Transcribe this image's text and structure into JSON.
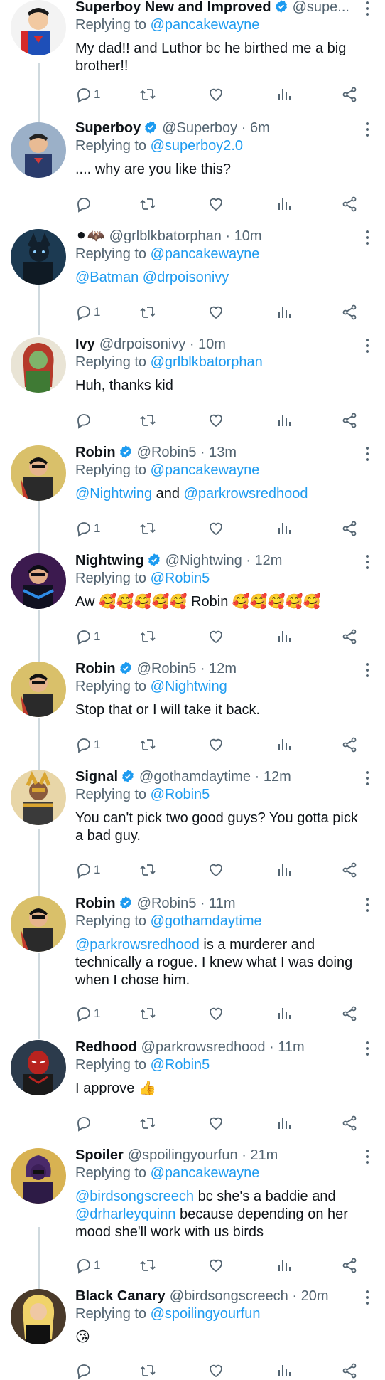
{
  "colors": {
    "link": "#1d9bf0",
    "muted": "#536471",
    "text": "#0f1419",
    "verified": "#1d9bf0"
  },
  "icons": [
    "reply-icon",
    "retweet-icon",
    "like-icon",
    "views-icon",
    "share-icon",
    "more-icon",
    "verified-badge-icon"
  ],
  "tweets": [
    {
      "name": "Superboy New and Improved",
      "verified": true,
      "handle": "@supe...",
      "time": "",
      "replying_label": "Replying to",
      "replying_to": "@pancakewayne",
      "body": "My dad!!  and Luthor bc he birthed me a big brother!!",
      "reply_count": "1"
    },
    {
      "name": "Superboy",
      "verified": true,
      "handle": "@Superboy · 6m",
      "time": "",
      "replying_label": "Replying to",
      "replying_to": "@superboy2.0",
      "body": ".... why are you like this?",
      "reply_count": ""
    },
    {
      "name": "⚫🦇",
      "verified": false,
      "handle": "@grlblkbatorphan · 10m",
      "replying_label": "Replying to",
      "replying_to": "@pancakewayne",
      "body_mention_1": "@Batman",
      "body_mention_2": "@drpoisonivy",
      "reply_count": "1"
    },
    {
      "name": "Ivy",
      "verified": false,
      "handle": "@drpoisonivy · 10m",
      "replying_label": "Replying to",
      "replying_to": "@grlblkbatorphan",
      "body": "Huh, thanks kid",
      "reply_count": ""
    },
    {
      "name": "Robin",
      "verified": true,
      "handle": "@Robin5 · 13m",
      "replying_label": "Replying to",
      "replying_to": "@pancakewayne",
      "body_mention_1": "@Nightwing",
      "body_mid": " and ",
      "body_mention_2": "@parkrowsredhood",
      "reply_count": "1"
    },
    {
      "name": "Nightwing",
      "verified": true,
      "handle": "@Nightwing · 12m",
      "replying_label": "Replying to",
      "replying_to": "@Robin5",
      "body_pre": "Aw ",
      "body_emoji_1": "🥰🥰🥰🥰🥰",
      "body_mid": " Robin ",
      "body_emoji_2": "🥰🥰🥰🥰🥰",
      "reply_count": "1"
    },
    {
      "name": "Robin",
      "verified": true,
      "handle": "@Robin5 · 12m",
      "replying_label": "Replying to",
      "replying_to": "@Nightwing",
      "body": "Stop that or I will take it back.",
      "reply_count": "1"
    },
    {
      "name": "Signal",
      "verified": true,
      "handle": "@gothamdaytime · 12m",
      "replying_label": "Replying to",
      "replying_to": "@Robin5",
      "body": "You can't pick two good guys? You gotta pick a bad guy.",
      "reply_count": "1"
    },
    {
      "name": "Robin",
      "verified": true,
      "handle": "@Robin5 · 11m",
      "replying_label": "Replying to",
      "replying_to": "@gothamdaytime",
      "body_mention_1": "@parkrowsredhood",
      "body_rest": " is a murderer and technically a rogue. I knew what I was doing when I chose him.",
      "reply_count": "1"
    },
    {
      "name": "Redhood",
      "verified": false,
      "handle": "@parkrowsredhood · 11m",
      "replying_label": "Replying to",
      "replying_to": "@Robin5",
      "body_pre": "I approve ",
      "body_emoji_1": "👍",
      "reply_count": ""
    },
    {
      "name": "Spoiler",
      "verified": false,
      "handle": "@spoilingyourfun · 21m",
      "replying_label": "Replying to",
      "replying_to": "@pancakewayne",
      "body_mention_1": "@birdsongscreech",
      "body_rest": " bc she's a baddie and ",
      "body_mention_2": "@drharleyquinn",
      "body_rest_2": " because depending on her mood she'll work with us birds",
      "reply_count": "1"
    },
    {
      "name": "Black Canary",
      "verified": false,
      "handle": "@birdsongscreech · 20m",
      "replying_label": "Replying to",
      "replying_to": "@spoilingyourfun",
      "body_emoji_1": "😘",
      "reply_count": ""
    }
  ]
}
